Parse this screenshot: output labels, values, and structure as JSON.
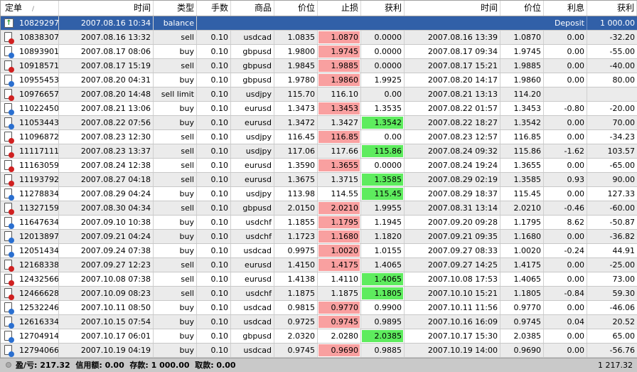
{
  "headers": [
    "定单",
    "时间",
    "类型",
    "手数",
    "商品",
    "价位",
    "止损",
    "获利",
    "时间",
    "价位",
    "利息",
    "获利"
  ],
  "balance_row": {
    "order": "10829297",
    "time": "2007.08.16 10:34",
    "type": "balance",
    "comment": "Deposit",
    "profit": "1 000.00"
  },
  "rows": [
    {
      "order": "10838307",
      "time": "2007.08.16 13:32",
      "type": "sell",
      "lots": "0.10",
      "symbol": "usdcad",
      "price": "1.0835",
      "sl": "1.0870",
      "tp": "0.0000",
      "close_time": "2007.08.16 13:39",
      "close_price": "1.0870",
      "swap": "0.00",
      "profit": "-32.20",
      "hit": "sl"
    },
    {
      "order": "10893901",
      "time": "2007.08.17 08:06",
      "type": "buy",
      "lots": "0.10",
      "symbol": "gbpusd",
      "price": "1.9800",
      "sl": "1.9745",
      "tp": "0.0000",
      "close_time": "2007.08.17 09:34",
      "close_price": "1.9745",
      "swap": "0.00",
      "profit": "-55.00",
      "hit": "sl"
    },
    {
      "order": "10918571",
      "time": "2007.08.17 15:19",
      "type": "sell",
      "lots": "0.10",
      "symbol": "gbpusd",
      "price": "1.9845",
      "sl": "1.9885",
      "tp": "0.0000",
      "close_time": "2007.08.17 15:21",
      "close_price": "1.9885",
      "swap": "0.00",
      "profit": "-40.00",
      "hit": "sl"
    },
    {
      "order": "10955453",
      "time": "2007.08.20 04:31",
      "type": "buy",
      "lots": "0.10",
      "symbol": "gbpusd",
      "price": "1.9780",
      "sl": "1.9860",
      "tp": "1.9925",
      "close_time": "2007.08.20 14:17",
      "close_price": "1.9860",
      "swap": "0.00",
      "profit": "80.00",
      "hit": "sl"
    },
    {
      "order": "10976657",
      "time": "2007.08.20 14:48",
      "type": "sell limit",
      "lots": "0.10",
      "symbol": "usdjpy",
      "price": "115.70",
      "sl": "116.10",
      "tp": "0.00",
      "close_time": "2007.08.21 13:13",
      "close_price": "114.20",
      "swap": "",
      "profit": "",
      "hit": ""
    },
    {
      "order": "11022450",
      "time": "2007.08.21 13:06",
      "type": "buy",
      "lots": "0.10",
      "symbol": "eurusd",
      "price": "1.3473",
      "sl": "1.3453",
      "tp": "1.3535",
      "close_time": "2007.08.22 01:57",
      "close_price": "1.3453",
      "swap": "-0.80",
      "profit": "-20.00",
      "hit": "sl"
    },
    {
      "order": "11053443",
      "time": "2007.08.22 07:56",
      "type": "buy",
      "lots": "0.10",
      "symbol": "eurusd",
      "price": "1.3472",
      "sl": "1.3427",
      "tp": "1.3542",
      "close_time": "2007.08.22 18:27",
      "close_price": "1.3542",
      "swap": "0.00",
      "profit": "70.00",
      "hit": "tp"
    },
    {
      "order": "11096872",
      "time": "2007.08.23 12:30",
      "type": "sell",
      "lots": "0.10",
      "symbol": "usdjpy",
      "price": "116.45",
      "sl": "116.85",
      "tp": "0.00",
      "close_time": "2007.08.23 12:57",
      "close_price": "116.85",
      "swap": "0.00",
      "profit": "-34.23",
      "hit": "sl"
    },
    {
      "order": "11117111",
      "time": "2007.08.23 13:37",
      "type": "sell",
      "lots": "0.10",
      "symbol": "usdjpy",
      "price": "117.06",
      "sl": "117.66",
      "tp": "115.86",
      "close_time": "2007.08.24 09:32",
      "close_price": "115.86",
      "swap": "-1.62",
      "profit": "103.57",
      "hit": "tp"
    },
    {
      "order": "11163059",
      "time": "2007.08.24 12:38",
      "type": "sell",
      "lots": "0.10",
      "symbol": "eurusd",
      "price": "1.3590",
      "sl": "1.3655",
      "tp": "0.0000",
      "close_time": "2007.08.24 19:24",
      "close_price": "1.3655",
      "swap": "0.00",
      "profit": "-65.00",
      "hit": "sl"
    },
    {
      "order": "11193792",
      "time": "2007.08.27 04:18",
      "type": "sell",
      "lots": "0.10",
      "symbol": "eurusd",
      "price": "1.3675",
      "sl": "1.3715",
      "tp": "1.3585",
      "close_time": "2007.08.29 02:19",
      "close_price": "1.3585",
      "swap": "0.93",
      "profit": "90.00",
      "hit": "tp"
    },
    {
      "order": "11278834",
      "time": "2007.08.29 04:24",
      "type": "buy",
      "lots": "0.10",
      "symbol": "usdjpy",
      "price": "113.98",
      "sl": "114.55",
      "tp": "115.45",
      "close_time": "2007.08.29 18:37",
      "close_price": "115.45",
      "swap": "0.00",
      "profit": "127.33",
      "hit": "tp"
    },
    {
      "order": "11327159",
      "time": "2007.08.30 04:34",
      "type": "sell",
      "lots": "0.10",
      "symbol": "gbpusd",
      "price": "2.0150",
      "sl": "2.0210",
      "tp": "1.9955",
      "close_time": "2007.08.31 13:14",
      "close_price": "2.0210",
      "swap": "-0.46",
      "profit": "-60.00",
      "hit": "sl"
    },
    {
      "order": "11647634",
      "time": "2007.09.10 10:38",
      "type": "buy",
      "lots": "0.10",
      "symbol": "usdchf",
      "price": "1.1855",
      "sl": "1.1795",
      "tp": "1.1945",
      "close_time": "2007.09.20 09:28",
      "close_price": "1.1795",
      "swap": "8.62",
      "profit": "-50.87",
      "hit": "sl"
    },
    {
      "order": "12013897",
      "time": "2007.09.21 04:24",
      "type": "buy",
      "lots": "0.10",
      "symbol": "usdchf",
      "price": "1.1723",
      "sl": "1.1680",
      "tp": "1.1820",
      "close_time": "2007.09.21 09:35",
      "close_price": "1.1680",
      "swap": "0.00",
      "profit": "-36.82",
      "hit": "sl"
    },
    {
      "order": "12051434",
      "time": "2007.09.24 07:38",
      "type": "buy",
      "lots": "0.10",
      "symbol": "usdcad",
      "price": "0.9975",
      "sl": "1.0020",
      "tp": "1.0155",
      "close_time": "2007.09.27 08:33",
      "close_price": "1.0020",
      "swap": "-0.24",
      "profit": "44.91",
      "hit": "sl"
    },
    {
      "order": "12168338",
      "time": "2007.09.27 12:23",
      "type": "sell",
      "lots": "0.10",
      "symbol": "eurusd",
      "price": "1.4150",
      "sl": "1.4175",
      "tp": "1.4065",
      "close_time": "2007.09.27 14:25",
      "close_price": "1.4175",
      "swap": "0.00",
      "profit": "-25.00",
      "hit": "sl"
    },
    {
      "order": "12432566",
      "time": "2007.10.08 07:38",
      "type": "sell",
      "lots": "0.10",
      "symbol": "eurusd",
      "price": "1.4138",
      "sl": "1.4110",
      "tp": "1.4065",
      "close_time": "2007.10.08 17:53",
      "close_price": "1.4065",
      "swap": "0.00",
      "profit": "73.00",
      "hit": "tp"
    },
    {
      "order": "12466628",
      "time": "2007.10.09 08:23",
      "type": "sell",
      "lots": "0.10",
      "symbol": "usdchf",
      "price": "1.1875",
      "sl": "1.1875",
      "tp": "1.1805",
      "close_time": "2007.10.10 15:21",
      "close_price": "1.1805",
      "swap": "-0.84",
      "profit": "59.30",
      "hit": "tp"
    },
    {
      "order": "12532246",
      "time": "2007.10.11 08:50",
      "type": "buy",
      "lots": "0.10",
      "symbol": "usdcad",
      "price": "0.9815",
      "sl": "0.9770",
      "tp": "0.9900",
      "close_time": "2007.10.11 11:56",
      "close_price": "0.9770",
      "swap": "0.00",
      "profit": "-46.06",
      "hit": "sl"
    },
    {
      "order": "12616334",
      "time": "2007.10.15 07:54",
      "type": "buy",
      "lots": "0.10",
      "symbol": "usdcad",
      "price": "0.9725",
      "sl": "0.9745",
      "tp": "0.9895",
      "close_time": "2007.10.16 16:09",
      "close_price": "0.9745",
      "swap": "0.04",
      "profit": "20.52",
      "hit": "sl"
    },
    {
      "order": "12704914",
      "time": "2007.10.17 06:01",
      "type": "buy",
      "lots": "0.10",
      "symbol": "gbpusd",
      "price": "2.0320",
      "sl": "2.0280",
      "tp": "2.0385",
      "close_time": "2007.10.17 15:30",
      "close_price": "2.0385",
      "swap": "0.00",
      "profit": "65.00",
      "hit": "tp"
    },
    {
      "order": "12794066",
      "time": "2007.10.19 04:19",
      "type": "buy",
      "lots": "0.10",
      "symbol": "usdcad",
      "price": "0.9745",
      "sl": "0.9690",
      "tp": "0.9885",
      "close_time": "2007.10.19 14:00",
      "close_price": "0.9690",
      "swap": "0.00",
      "profit": "-56.76",
      "hit": "sl"
    }
  ],
  "footer": {
    "summary": "盈/亏: 217.32  信用额: 0.00  存款: 1 000.00  取款: 0.00",
    "total": "1 217.32"
  },
  "colors": {
    "selected": "#3160a8",
    "sl_hit": "#f9a0a0",
    "tp_hit": "#5eec5e",
    "sell_dot": "#d02020",
    "buy_dot": "#2a6fd0"
  }
}
